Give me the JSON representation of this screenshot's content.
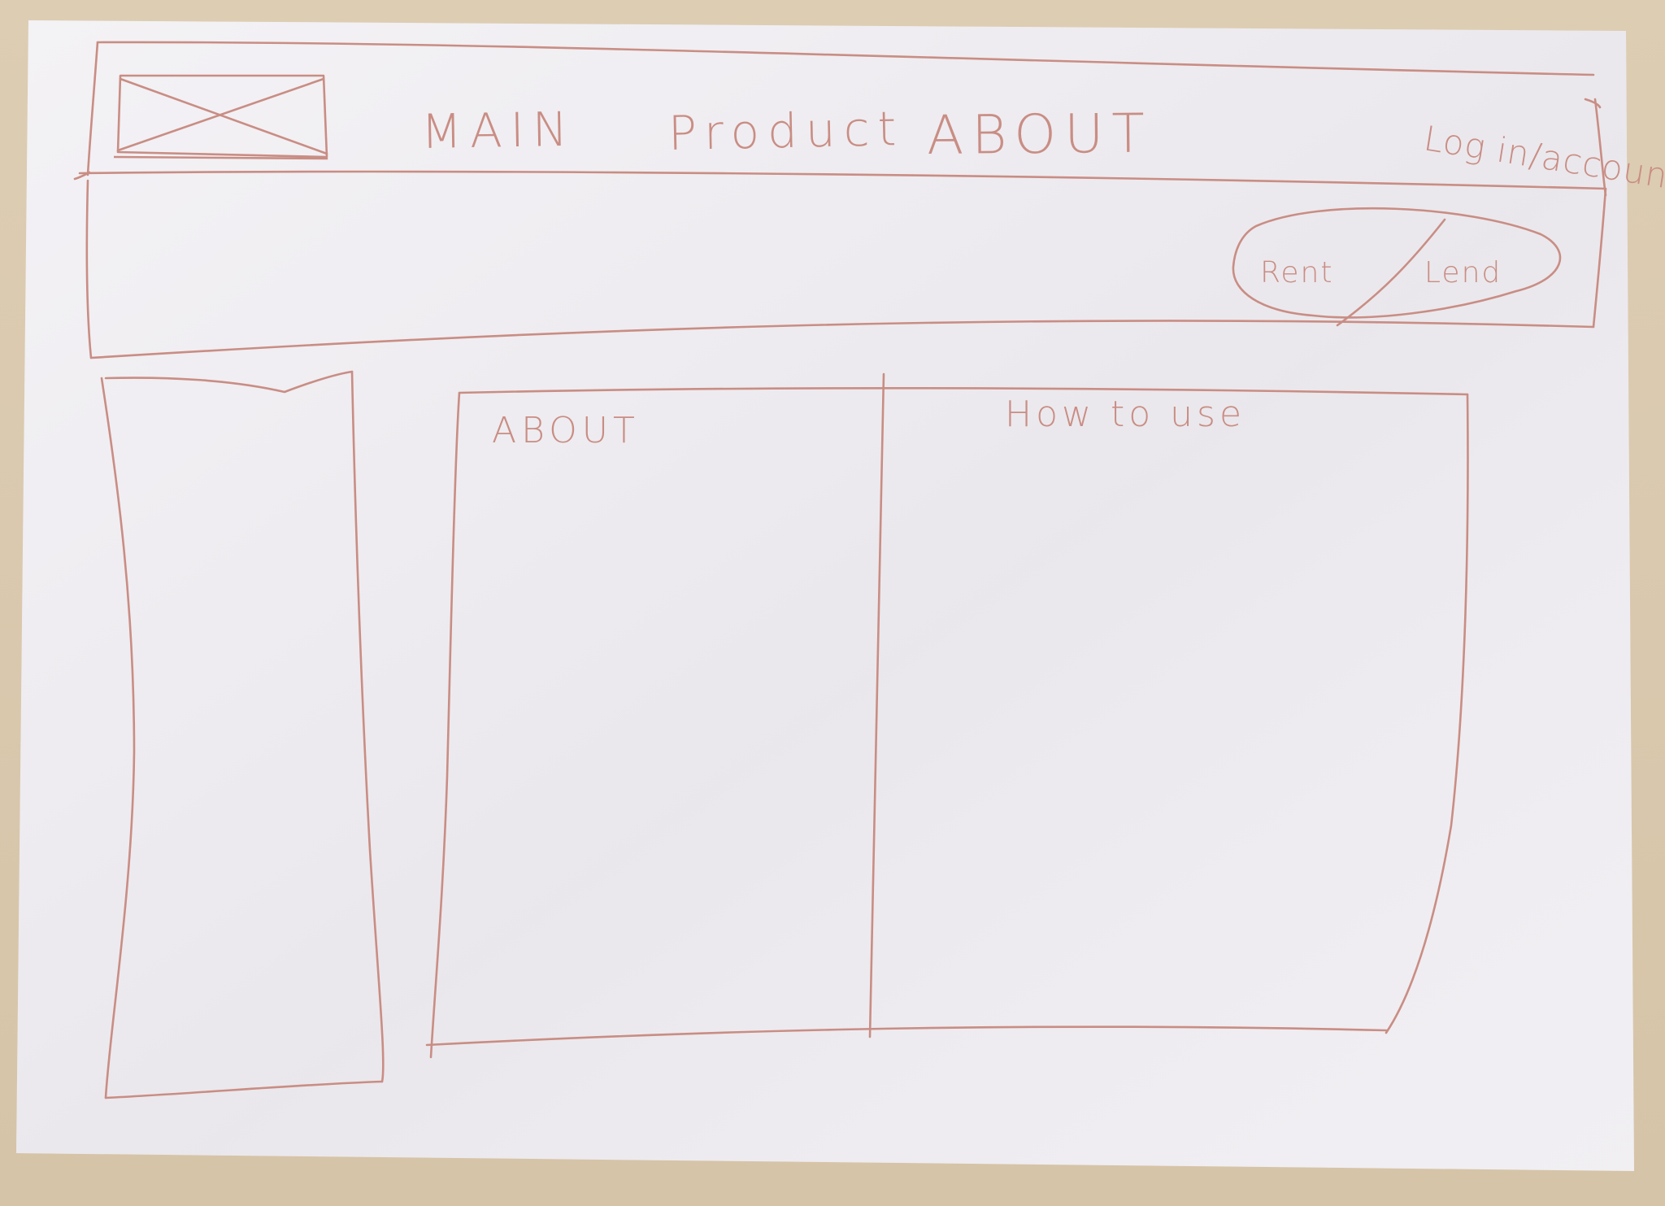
{
  "nav": {
    "items": [
      {
        "label": "MAIN"
      },
      {
        "label": "Product"
      },
      {
        "label": "ABOUT"
      }
    ],
    "login_label": "Log in/account"
  },
  "hero": {
    "toggle": {
      "rent_label": "Rent",
      "lend_label": "Lend"
    }
  },
  "content": {
    "about_title": "ABOUT",
    "howto_title": "How to use"
  },
  "colors": {
    "ink": "#c98d84",
    "paper": "#f3f0f3",
    "desk": "#d8c7ab"
  }
}
